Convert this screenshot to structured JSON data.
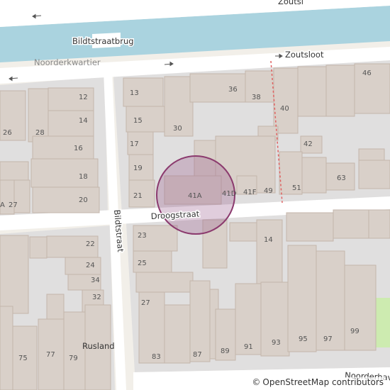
{
  "map": {
    "streets": {
      "bildtstraatbrug": "Bildtstraatbrug",
      "zoutsloot": "Zoutsloot",
      "droogstraat": "Droogstraat",
      "bildtstraat": "Bildtstraat",
      "noorderhaven": "Noorderhav",
      "zoutsloot_top": "Zoutsl"
    },
    "places": {
      "noorderkwartier": "Noorderkwartier",
      "rusland": "Rusland"
    },
    "house_numbers": [
      "12",
      "13",
      "14",
      "15",
      "16",
      "17",
      "18",
      "19",
      "20",
      "21",
      "22",
      "23",
      "24",
      "25",
      "26",
      "27",
      "28",
      "30",
      "32",
      "34",
      "36",
      "38",
      "40",
      "41A",
      "41D",
      "41F",
      "42",
      "46",
      "49",
      "51",
      "63",
      "75",
      "77",
      "79",
      "83",
      "87",
      "89",
      "91",
      "93",
      "95",
      "97",
      "99",
      "14",
      "27",
      "A"
    ],
    "marker": {
      "color": "#8b3a6e",
      "fill": "rgba(153,90,140,0.3)"
    },
    "colors": {
      "land": "#f2efe9",
      "building": "#d9d0c9",
      "building_stroke": "#c4b6ab",
      "residential": "#e0dfdf",
      "road": "#ffffff",
      "water": "#aad3df",
      "grass": "#cdebb0",
      "boundary": "#e06060"
    }
  },
  "attribution": {
    "copyright_symbol": "©",
    "text": "OpenStreetMap contributors"
  }
}
